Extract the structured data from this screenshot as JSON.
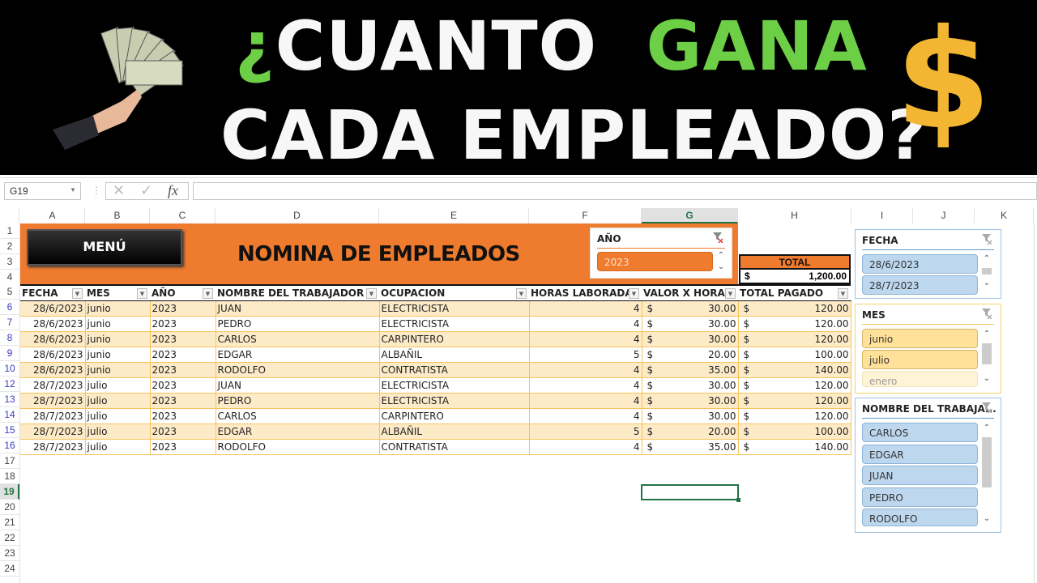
{
  "banner": {
    "line1_prefix": "¿",
    "line1_word1": "CUANTO",
    "line1_word2": "GANA",
    "line2": "CADA EMPLEADO?",
    "dollar_symbol": "$",
    "colors": {
      "text": "#f7f7f7",
      "accent_green": "#6ccf46",
      "dollar_gold": "#f2b632"
    }
  },
  "formula_bar": {
    "name_box": "G19",
    "cancel_icon": "✕",
    "enter_icon": "✓",
    "fx_label": "fx",
    "formula": ""
  },
  "columns": [
    "A",
    "B",
    "C",
    "D",
    "E",
    "F",
    "G",
    "H",
    "I",
    "J",
    "K"
  ],
  "selected_column": "G",
  "rows": [
    "1",
    "2",
    "3",
    "4",
    "5",
    "6",
    "7",
    "8",
    "9",
    "10",
    "12",
    "13",
    "14",
    "15",
    "16",
    "17",
    "18",
    "19",
    "20",
    "21",
    "22",
    "23",
    "24"
  ],
  "selected_row": "19",
  "sheet": {
    "menu_button": "MENÚ",
    "title": "NOMINA DE EMPLEADOS",
    "total_label": "TOTAL",
    "total_currency": "$",
    "total_value": "1,200.00",
    "accent_color": "#ef7b2e"
  },
  "table": {
    "headers": [
      "FECHA",
      "MES",
      "AÑO",
      "NOMBRE DEL TRABAJADOR",
      "OCUPACION",
      "HORAS LABORADAS",
      "VALOR X HORA",
      "TOTAL PAGADO"
    ],
    "rows": [
      {
        "fecha": "28/6/2023",
        "mes": "junio",
        "anio": "2023",
        "nombre": "JUAN",
        "ocupacion": "ELECTRICISTA",
        "horas": "4",
        "valor": "30.00",
        "total": "120.00"
      },
      {
        "fecha": "28/6/2023",
        "mes": "junio",
        "anio": "2023",
        "nombre": "PEDRO",
        "ocupacion": "ELECTRICISTA",
        "horas": "4",
        "valor": "30.00",
        "total": "120.00"
      },
      {
        "fecha": "28/6/2023",
        "mes": "junio",
        "anio": "2023",
        "nombre": "CARLOS",
        "ocupacion": "CARPINTERO",
        "horas": "4",
        "valor": "30.00",
        "total": "120.00"
      },
      {
        "fecha": "28/6/2023",
        "mes": "junio",
        "anio": "2023",
        "nombre": "EDGAR",
        "ocupacion": "ALBAÑIL",
        "horas": "5",
        "valor": "20.00",
        "total": "100.00"
      },
      {
        "fecha": "28/6/2023",
        "mes": "junio",
        "anio": "2023",
        "nombre": "RODOLFO",
        "ocupacion": "CONTRATISTA",
        "horas": "4",
        "valor": "35.00",
        "total": "140.00"
      },
      {
        "fecha": "28/7/2023",
        "mes": "julio",
        "anio": "2023",
        "nombre": "JUAN",
        "ocupacion": "ELECTRICISTA",
        "horas": "4",
        "valor": "30.00",
        "total": "120.00"
      },
      {
        "fecha": "28/7/2023",
        "mes": "julio",
        "anio": "2023",
        "nombre": "PEDRO",
        "ocupacion": "ELECTRICISTA",
        "horas": "4",
        "valor": "30.00",
        "total": "120.00"
      },
      {
        "fecha": "28/7/2023",
        "mes": "julio",
        "anio": "2023",
        "nombre": "CARLOS",
        "ocupacion": "CARPINTERO",
        "horas": "4",
        "valor": "30.00",
        "total": "120.00"
      },
      {
        "fecha": "28/7/2023",
        "mes": "julio",
        "anio": "2023",
        "nombre": "EDGAR",
        "ocupacion": "ALBAÑIL",
        "horas": "5",
        "valor": "20.00",
        "total": "100.00"
      },
      {
        "fecha": "28/7/2023",
        "mes": "julio",
        "anio": "2023",
        "nombre": "RODOLFO",
        "ocupacion": "CONTRATISTA",
        "horas": "4",
        "valor": "35.00",
        "total": "140.00"
      }
    ],
    "currency": "$"
  },
  "slicers": {
    "anio": {
      "title": "AÑO",
      "items": [
        "2023"
      ]
    },
    "fecha": {
      "title": "FECHA",
      "items": [
        "28/6/2023",
        "28/7/2023"
      ]
    },
    "mes": {
      "title": "MES",
      "items": [
        "junio",
        "julio",
        "enero"
      ]
    },
    "nombre": {
      "title": "NOMBRE DEL TRABAJA...",
      "items": [
        "CARLOS",
        "EDGAR",
        "JUAN",
        "PEDRO",
        "RODOLFO"
      ]
    }
  }
}
